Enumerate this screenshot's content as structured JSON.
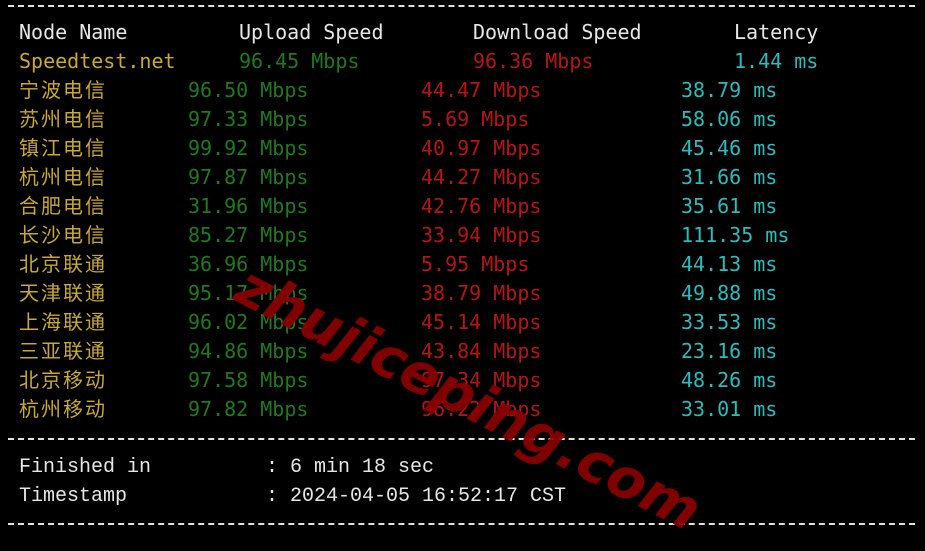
{
  "header": {
    "node_name": "Node Name",
    "upload_speed": "Upload Speed",
    "download_speed": "Download Speed",
    "latency": "Latency"
  },
  "rows": [
    {
      "node": "Speedtest.net",
      "upload": "96.45 Mbps",
      "download": "96.36 Mbps",
      "latency": "1.44 ms"
    },
    {
      "node": "宁波电信",
      "upload": "96.50 Mbps",
      "download": "44.47 Mbps",
      "latency": "38.79 ms"
    },
    {
      "node": "苏州电信",
      "upload": "97.33 Mbps",
      "download": "5.69 Mbps",
      "latency": "58.06 ms"
    },
    {
      "node": "镇江电信",
      "upload": "99.92 Mbps",
      "download": "40.97 Mbps",
      "latency": "45.46 ms"
    },
    {
      "node": "杭州电信",
      "upload": "97.87 Mbps",
      "download": "44.27 Mbps",
      "latency": "31.66 ms"
    },
    {
      "node": "合肥电信",
      "upload": "31.96 Mbps",
      "download": "42.76 Mbps",
      "latency": "35.61 ms"
    },
    {
      "node": "长沙电信",
      "upload": "85.27 Mbps",
      "download": "33.94 Mbps",
      "latency": "111.35 ms"
    },
    {
      "node": "北京联通",
      "upload": "36.96 Mbps",
      "download": "5.95 Mbps",
      "latency": "44.13 ms"
    },
    {
      "node": "天津联通",
      "upload": "95.17 Mbps",
      "download": "38.79 Mbps",
      "latency": "49.88 ms"
    },
    {
      "node": "上海联通",
      "upload": "96.02 Mbps",
      "download": "45.14 Mbps",
      "latency": "33.53 ms"
    },
    {
      "node": "三亚联通",
      "upload": "94.86 Mbps",
      "download": "43.84 Mbps",
      "latency": "23.16 ms"
    },
    {
      "node": "北京移动",
      "upload": "97.58 Mbps",
      "download": "97.34 Mbps",
      "latency": "48.26 ms"
    },
    {
      "node": "杭州移动",
      "upload": "97.82 Mbps",
      "download": "96.22 Mbps",
      "latency": "33.01 ms"
    }
  ],
  "footer": {
    "finished_label": "Finished in",
    "finished_value": ": 6 min 18 sec",
    "timestamp_label": "Timestamp",
    "timestamp_value": ": 2024-04-05 16:52:17 CST"
  },
  "watermark": "zhujiceping.com",
  "colors": {
    "node": "#c8a837",
    "upload": "#1f7a1f",
    "download": "#b81414",
    "latency": "#2bbcbc",
    "watermark": "#8b0000"
  }
}
